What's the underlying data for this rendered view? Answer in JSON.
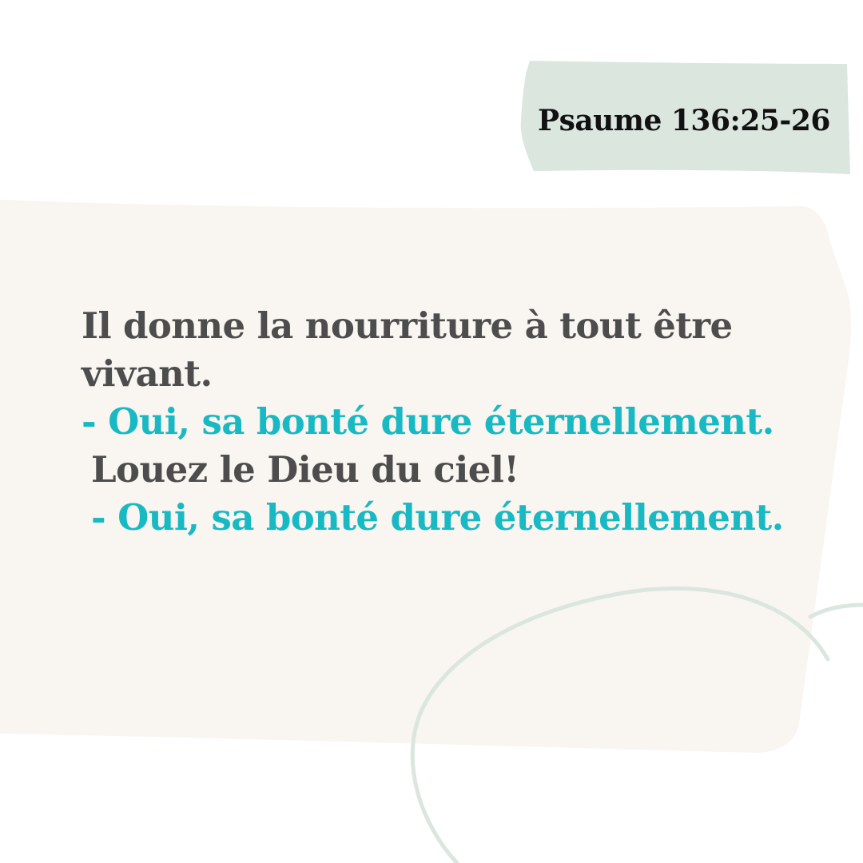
{
  "reference": "Psaume 136:25-26",
  "verse_lines": [
    "Il donne la nourriture à tout être",
    "vivant.",
    "- Oui, sa bonté dure éternellement.",
    "Louez le Dieu du ciel!",
    "- Oui, sa bonté dure éternellement."
  ],
  "colors": {
    "background": "#ffffff",
    "panel": "#f9f5f0",
    "reference_tag": "#dbe6df",
    "dark_text": "#4d4d4d",
    "teal_text": "#19b9c4",
    "swirl": "#dbe6df"
  }
}
